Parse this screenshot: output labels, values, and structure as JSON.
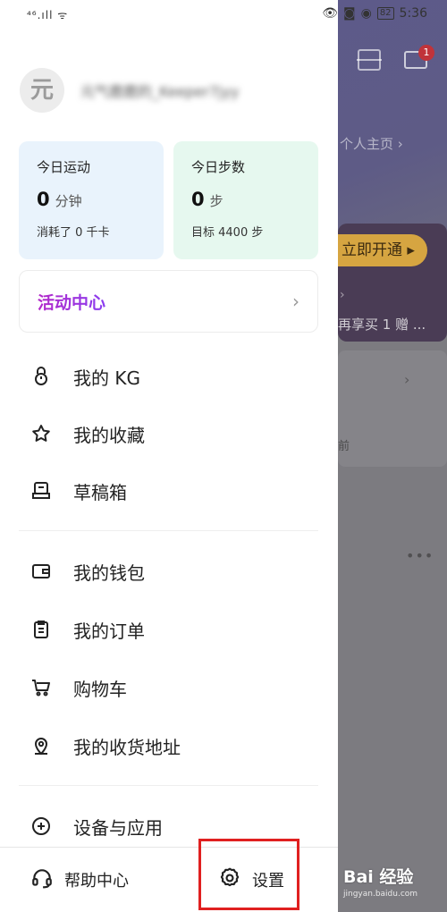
{
  "status_bar": {
    "left": "⁴⁶.ıll ᯤ",
    "time": "5:36",
    "battery": "82"
  },
  "background": {
    "mail_badge": "1",
    "home_link": "个人主页 ›",
    "vip_button": "立即开通 ▸",
    "vip_promo": "再享买 1 赠 ...",
    "card_text": "前"
  },
  "drawer": {
    "avatar_char": "元",
    "username": "元气鹿鹿的_Keeper7jyy",
    "stats": [
      {
        "title": "今日运动",
        "value": "0",
        "unit": "分钟",
        "sub": "消耗了 0 千卡"
      },
      {
        "title": "今日步数",
        "value": "0",
        "unit": "步",
        "sub": "目标 4400 步"
      }
    ],
    "activity_center": "活动中心",
    "menu_groups": [
      [
        {
          "icon": "kettlebell-icon",
          "label": "我的 KG"
        },
        {
          "icon": "star-icon",
          "label": "我的收藏"
        },
        {
          "icon": "drafts-icon",
          "label": "草稿箱"
        }
      ],
      [
        {
          "icon": "wallet-icon",
          "label": "我的钱包"
        },
        {
          "icon": "order-icon",
          "label": "我的订单"
        },
        {
          "icon": "cart-icon",
          "label": "购物车"
        },
        {
          "icon": "location-pin-icon",
          "label": "我的收货地址"
        }
      ],
      [
        {
          "icon": "add-circle-icon",
          "label": "设备与应用"
        }
      ]
    ],
    "footer": {
      "help": "帮助中心",
      "settings": "设置"
    }
  },
  "watermark": {
    "main": "Bai 经验",
    "sub": "jingyan.baidu.com"
  },
  "colors": {
    "highlight_box": "#e02020",
    "activity_gradient": [
      "#b329c9",
      "#8a3df0"
    ],
    "sport_card": "#e9f3fc",
    "steps_card": "#e6f8ef"
  }
}
